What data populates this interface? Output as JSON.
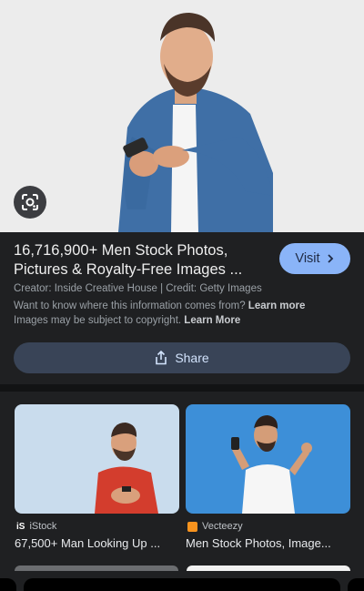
{
  "result": {
    "title": "16,716,900+ Men Stock Photos, Pictures & Royalty-Free Images ...",
    "visit_label": "Visit",
    "creator_line": "Creator: Inside Creative House | Credit: Getty Images",
    "info_question": "Want to know where this information comes from?",
    "info_link": "Learn more",
    "copyright_text": "Images may be subject to copyright.",
    "copyright_link": "Learn More",
    "share_label": "Share"
  },
  "related": [
    {
      "source": "iStock",
      "caption": "67,500+ Man Looking Up ..."
    },
    {
      "source": "Vecteezy",
      "caption": "Men Stock Photos, Image..."
    }
  ],
  "colors": {
    "accent": "#8ab4f8",
    "background": "#1f2022",
    "share_bg": "#394457"
  },
  "icons": [
    "google-lens-icon",
    "chevron-right-icon",
    "share-icon",
    "istock-logo-icon",
    "vecteezy-logo-icon"
  ]
}
